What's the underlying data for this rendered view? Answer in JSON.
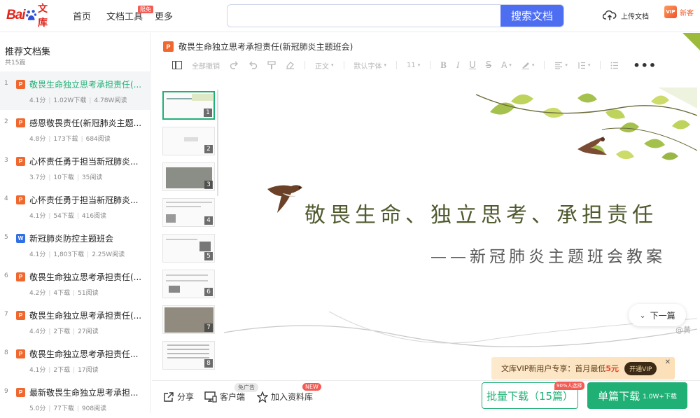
{
  "header": {
    "logo_text": "Bai",
    "logo_suffix": "文库",
    "nav": [
      "首页",
      "文档工具",
      "更多"
    ],
    "free_badge": "限免",
    "search_placeholder": "",
    "search_button": "搜索文档",
    "upload_label": "上传文档",
    "new_guest_label": "新客",
    "vip_badge": "VIP"
  },
  "sidebar": {
    "title": "推荐文档集",
    "count": "共15篇",
    "items": [
      {
        "num": "1",
        "type": "P",
        "name": "敬畏生命独立思考承担责任(...",
        "score": "4.1分",
        "downloads": "1.02W下载",
        "reads": "4.78W阅读"
      },
      {
        "num": "2",
        "type": "P",
        "name": "感恩敬畏责任(新冠肺炎主题...",
        "score": "4.8分",
        "downloads": "173下载",
        "reads": "684阅读"
      },
      {
        "num": "3",
        "type": "P",
        "name": "心怀责任勇于担当新冠肺炎...",
        "score": "3.7分",
        "downloads": "10下载",
        "reads": "35阅读"
      },
      {
        "num": "4",
        "type": "P",
        "name": "心怀责任勇于担当新冠肺炎...",
        "score": "4.1分",
        "downloads": "54下载",
        "reads": "416阅读"
      },
      {
        "num": "5",
        "type": "W",
        "name": "新冠肺炎防控主题班会",
        "score": "4.1分",
        "downloads": "1,803下载",
        "reads": "2.25W阅读"
      },
      {
        "num": "6",
        "type": "P",
        "name": "敬畏生命独立思考承担责任(...",
        "score": "4.2分",
        "downloads": "4下载",
        "reads": "51阅读"
      },
      {
        "num": "7",
        "type": "P",
        "name": "敬畏生命独立思考承担责任(...",
        "score": "4.4分",
        "downloads": "2下载",
        "reads": "27阅读"
      },
      {
        "num": "8",
        "type": "P",
        "name": "敬畏生命独立思考承担责任...",
        "score": "4.1分",
        "downloads": "2下载",
        "reads": "17阅读"
      },
      {
        "num": "9",
        "type": "P",
        "name": "最新敬畏生命独立思考承担...",
        "score": "5.0分",
        "downloads": "77下载",
        "reads": "908阅读"
      }
    ]
  },
  "document": {
    "type": "P",
    "title": "敬畏生命独立思考承担责任(新冠肺炎主题班会)"
  },
  "toolbar": {
    "undo_all": "全部撤销",
    "style": "正文",
    "font": "默认字体",
    "size": "11",
    "more": "•••"
  },
  "thumbnails": [
    "1",
    "2",
    "3",
    "4",
    "5",
    "6",
    "7",
    "8"
  ],
  "slide": {
    "title": "敬畏生命、独立思考、承担责任",
    "subtitle": "——新冠肺炎主题班会教案",
    "watermark": "@黄"
  },
  "next_page": "下一篇",
  "vip_promo": {
    "text": "文库VIP新用户专享：首月最低",
    "price": "5元",
    "button": "开通VIP",
    "close": "✕"
  },
  "bottom": {
    "share": "分享",
    "client": "客户端",
    "ad_free": "免广告",
    "add_library": "加入资料库",
    "new_tag": "NEW",
    "batch_download": "批量下载（15篇）",
    "batch_percent": "90%人选择",
    "single_download": "单篇下载",
    "single_sub": "1.0W+下载"
  },
  "colors": {
    "brand_green": "#20b075",
    "search_blue": "#4e6ef2",
    "baidu_red": "#e1261c",
    "ppt_orange": "#f0682d",
    "word_blue": "#2f6fe8"
  }
}
